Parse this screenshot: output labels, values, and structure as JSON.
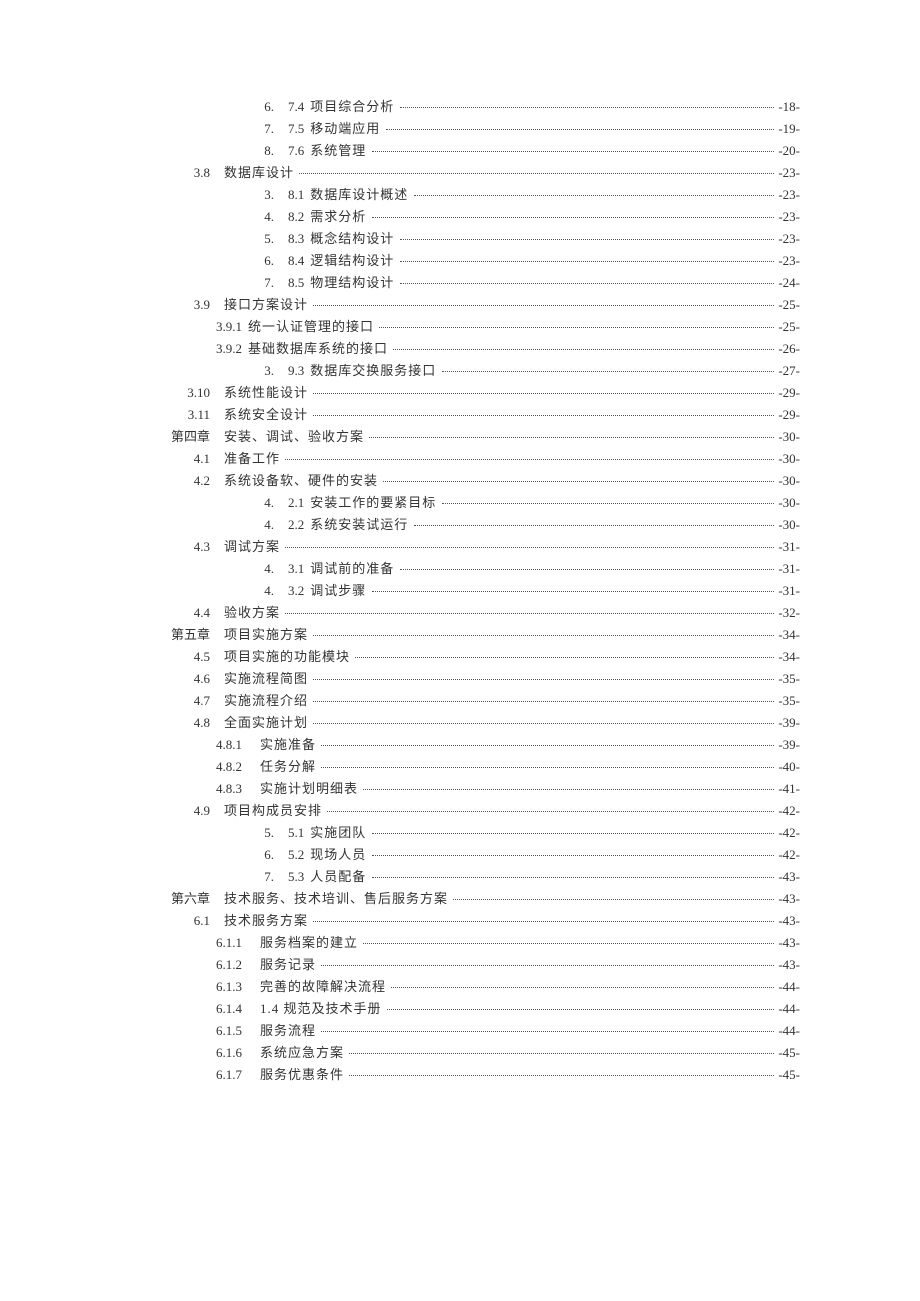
{
  "toc": [
    {
      "indent": "indent-2",
      "num": "6.",
      "prefix": "7.4",
      "title": "项目综合分析",
      "page": "-18-"
    },
    {
      "indent": "indent-2",
      "num": "7.",
      "prefix": "7.5",
      "title": "移动端应用",
      "page": "-19-"
    },
    {
      "indent": "indent-2",
      "num": "8.",
      "prefix": "7.6",
      "title": "系统管理",
      "page": "-20-"
    },
    {
      "indent": "indent-1",
      "num": "3.8",
      "prefix": "",
      "title": "数据库设计",
      "page": "-23-"
    },
    {
      "indent": "indent-2",
      "num": "3.",
      "prefix": "8.1",
      "title": "数据库设计概述",
      "page": "-23-"
    },
    {
      "indent": "indent-2",
      "num": "4.",
      "prefix": "8.2",
      "title": "需求分析",
      "page": "-23-"
    },
    {
      "indent": "indent-2",
      "num": "5.",
      "prefix": "8.3",
      "title": "概念结构设计",
      "page": "-23-"
    },
    {
      "indent": "indent-2",
      "num": "6.",
      "prefix": "8.4",
      "title": "逻辑结构设计",
      "page": "-23-"
    },
    {
      "indent": "indent-2",
      "num": "7.",
      "prefix": "8.5",
      "title": "物理结构设计",
      "page": "-24-"
    },
    {
      "indent": "indent-1",
      "num": "3.9",
      "prefix": "",
      "title": "接口方案设计",
      "page": "-25-"
    },
    {
      "indent": "indent-2b",
      "num": "",
      "prefix": "3.9.1",
      "title": "统一认证管理的接口",
      "page": "-25-"
    },
    {
      "indent": "indent-2b",
      "num": "",
      "prefix": "3.9.2",
      "title": "基础数据库系统的接口",
      "page": "-26-"
    },
    {
      "indent": "indent-2",
      "num": "3.",
      "prefix": "9.3",
      "title": "数据库交换服务接口",
      "page": "-27-"
    },
    {
      "indent": "indent-1",
      "num": "3.10",
      "prefix": "",
      "title": "系统性能设计",
      "page": "-29-"
    },
    {
      "indent": "indent-1",
      "num": "3.11",
      "prefix": "",
      "title": "系统安全设计",
      "page": "-29-"
    },
    {
      "indent": "indent-0",
      "num": "第四章",
      "prefix": "",
      "title": "安装、调试、验收方案",
      "page": "-30-"
    },
    {
      "indent": "indent-1",
      "num": "4.1",
      "prefix": "",
      "title": "准备工作",
      "page": "-30-"
    },
    {
      "indent": "indent-1",
      "num": "4.2",
      "prefix": "",
      "title": "系统设备软、硬件的安装",
      "page": "-30-"
    },
    {
      "indent": "indent-2",
      "num": "4.",
      "prefix": "2.1",
      "title": "安装工作的要紧目标",
      "page": "-30-"
    },
    {
      "indent": "indent-2",
      "num": "4.",
      "prefix": "2.2",
      "title": "系统安装试运行",
      "page": "-30-"
    },
    {
      "indent": "indent-1",
      "num": "4.3",
      "prefix": "",
      "title": "调试方案",
      "page": "-31-"
    },
    {
      "indent": "indent-2",
      "num": "4.",
      "prefix": "3.1",
      "title": "调试前的准备",
      "page": "-31-"
    },
    {
      "indent": "indent-2",
      "num": "4.",
      "prefix": "3.2",
      "title": "调试步骤",
      "page": "-31-"
    },
    {
      "indent": "indent-1",
      "num": "4.4",
      "prefix": "",
      "title": "验收方案",
      "page": "-32-"
    },
    {
      "indent": "indent-0",
      "num": "第五章",
      "prefix": "",
      "title": "项目实施方案",
      "page": "-34-"
    },
    {
      "indent": "indent-1",
      "num": "4.5",
      "prefix": "",
      "title": "项目实施的功能模块",
      "page": "-34-"
    },
    {
      "indent": "indent-1",
      "num": "4.6",
      "prefix": "",
      "title": "实施流程简图",
      "page": "-35-"
    },
    {
      "indent": "indent-1",
      "num": "4.7",
      "prefix": "",
      "title": "实施流程介绍",
      "page": "-35-"
    },
    {
      "indent": "indent-1",
      "num": "4.8",
      "prefix": "",
      "title": "全面实施计划",
      "page": "-39-"
    },
    {
      "indent": "indent-2c",
      "num": "",
      "prefix": "4.8.1",
      "title": "实施准备",
      "page": "-39-"
    },
    {
      "indent": "indent-2c",
      "num": "",
      "prefix": "4.8.2",
      "title": "任务分解",
      "page": "-40-"
    },
    {
      "indent": "indent-2c",
      "num": "",
      "prefix": "4.8.3",
      "title": "实施计划明细表",
      "page": "-41-"
    },
    {
      "indent": "indent-1",
      "num": "4.9",
      "prefix": "",
      "title": "项目构成员安排",
      "page": "-42-"
    },
    {
      "indent": "indent-2",
      "num": "5.",
      "prefix": "5.1",
      "title": "实施团队",
      "page": "-42-"
    },
    {
      "indent": "indent-2",
      "num": "6.",
      "prefix": "5.2",
      "title": "现场人员",
      "page": "-42-"
    },
    {
      "indent": "indent-2",
      "num": "7.",
      "prefix": "5.3",
      "title": "人员配备",
      "page": "-43-"
    },
    {
      "indent": "indent-0",
      "num": "第六章",
      "prefix": "",
      "title": "技术服务、技术培训、售后服务方案",
      "page": "-43-"
    },
    {
      "indent": "indent-1",
      "num": "6.1",
      "prefix": "",
      "title": "技术服务方案",
      "page": "-43-"
    },
    {
      "indent": "indent-2c",
      "num": "",
      "prefix": "6.1.1",
      "title": "服务档案的建立",
      "page": "-43-"
    },
    {
      "indent": "indent-2c",
      "num": "",
      "prefix": "6.1.2",
      "title": "服务记录",
      "page": "-43-"
    },
    {
      "indent": "indent-2c",
      "num": "",
      "prefix": "6.1.3",
      "title": "完善的故障解决流程",
      "page": "-44-"
    },
    {
      "indent": "indent-2c",
      "num": "",
      "prefix": "6.1.4",
      "title": "1.4 规范及技术手册",
      "page": "-44-"
    },
    {
      "indent": "indent-2c",
      "num": "",
      "prefix": "6.1.5",
      "title": "服务流程",
      "page": "-44-"
    },
    {
      "indent": "indent-2c",
      "num": "",
      "prefix": "6.1.6",
      "title": "系统应急方案",
      "page": "-45-"
    },
    {
      "indent": "indent-2c",
      "num": "",
      "prefix": "6.1.7",
      "title": "服务优惠条件",
      "page": "-45-"
    }
  ]
}
